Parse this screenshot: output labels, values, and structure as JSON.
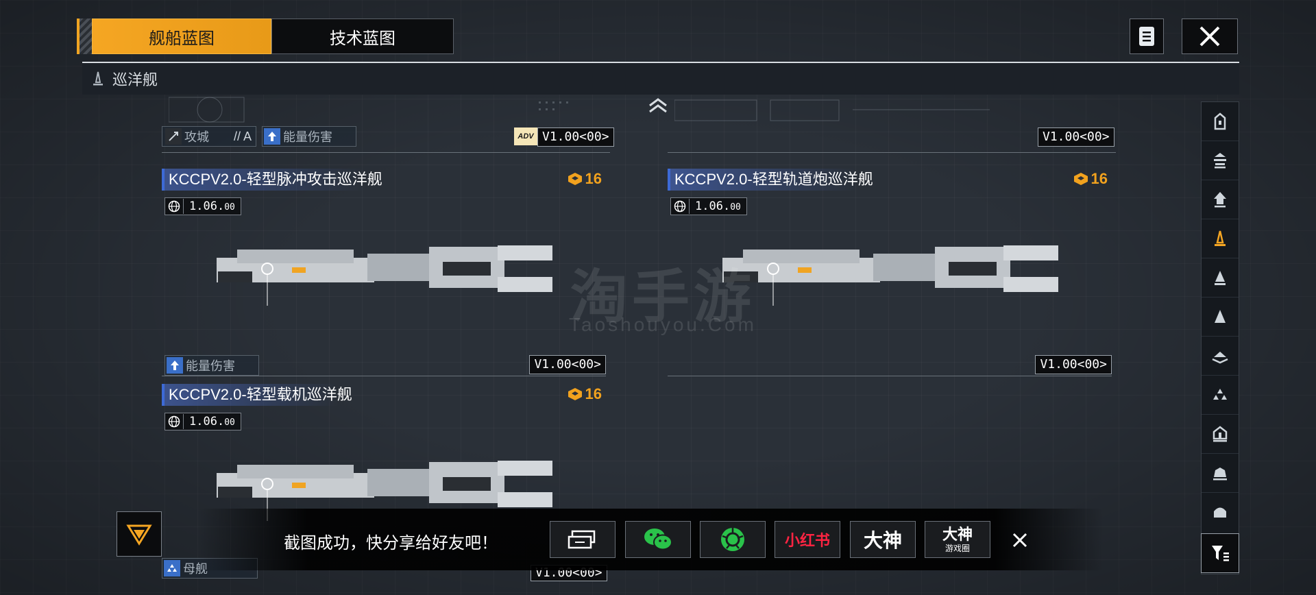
{
  "tabs": {
    "ship_blueprint": "舰船蓝图",
    "tech_blueprint": "技术蓝图"
  },
  "category": {
    "label": "巡洋舰"
  },
  "top_row": {
    "left_trait": "攻城",
    "left_trait_grade": "// A",
    "left_trait2": "能量伤害",
    "left_adv": "ADV",
    "left_version": "V1.00<00>",
    "right_version": "V1.00<00>"
  },
  "cards": [
    {
      "name": "KCCPV2.0-轻型脉冲攻击巡洋舰",
      "cost": "16",
      "version": "1.06",
      "version_sub": "00",
      "trait": "能量伤害",
      "bp_version": "V1.00<00>"
    },
    {
      "name": "KCCPV2.0-轻型轨道炮巡洋舰",
      "cost": "16",
      "version": "1.06",
      "version_sub": "00",
      "trait": "",
      "bp_version": "V1.00<00>"
    },
    {
      "name": "KCCPV2.0-轻型载机巡洋舰",
      "cost": "16",
      "version": "1.06",
      "version_sub": "00",
      "trait": "母舰",
      "bp_version": "V1.00<00>"
    }
  ],
  "watermark": {
    "main": "淘手游",
    "sub": "Taoshouyou.Com"
  },
  "share": {
    "message": "截图成功，快分享给好友吧！",
    "buttons": [
      "screenshot-share",
      "wechat",
      "moments",
      "小红书",
      "大神",
      "大神游戏圈"
    ],
    "xiaohongshu": "小红书",
    "dashen": "大神",
    "dashen_circle_top": "大神",
    "dashen_circle_bottom": "游戏圈"
  },
  "colors": {
    "accent": "#f5a623",
    "blue": "#3d6ad6",
    "wechat": "#2ac24a",
    "xhs": "#ff2442"
  },
  "sidebar_icons": [
    "cruiser-class-1-icon",
    "cruiser-class-2-icon",
    "cruiser-class-3-icon",
    "cruiser-selected-icon",
    "frigate-icon",
    "destroyer-icon",
    "carrier-icon",
    "support-icon",
    "battleship-icon",
    "dreadnought-icon",
    "flagship-icon"
  ]
}
